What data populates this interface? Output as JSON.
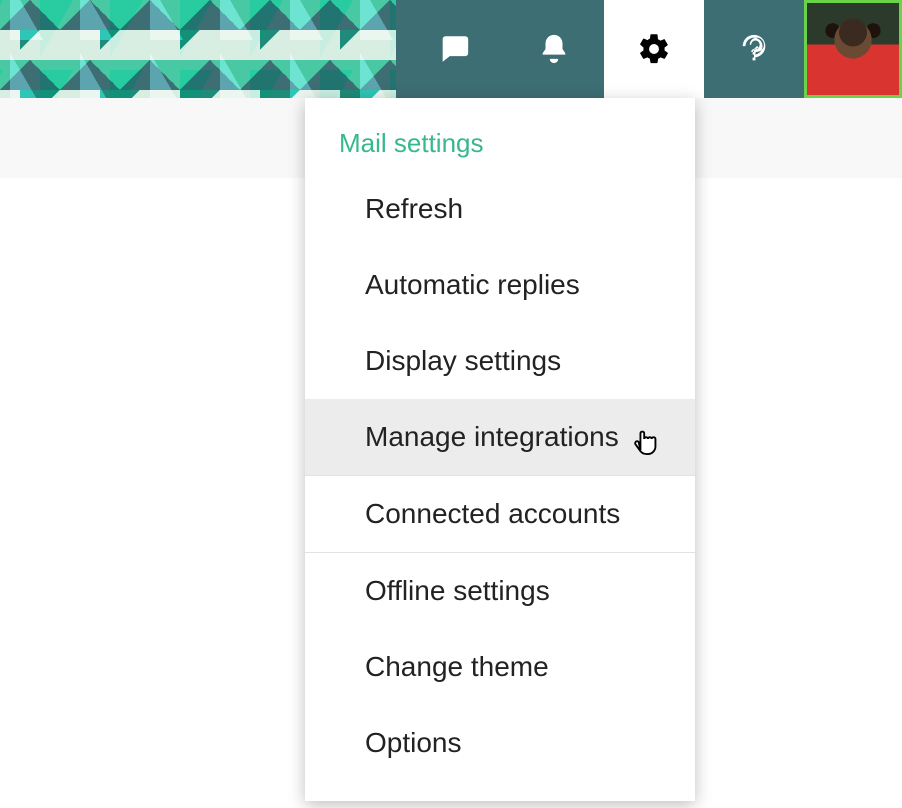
{
  "header": {
    "icons": {
      "chat": "chat-icon",
      "notifications": "bell-icon",
      "settings": "gear-icon",
      "help": "help-icon",
      "avatar": "user-avatar"
    }
  },
  "dropdown": {
    "heading": "Mail settings",
    "items": [
      {
        "label": "Refresh"
      },
      {
        "label": "Automatic replies"
      },
      {
        "label": "Display settings"
      },
      {
        "label": "Manage integrations",
        "hover": true,
        "divider_after": true
      },
      {
        "label": "Connected accounts",
        "divider_after": true
      },
      {
        "label": "Offline settings"
      },
      {
        "label": "Change theme"
      },
      {
        "label": "Options"
      }
    ]
  }
}
